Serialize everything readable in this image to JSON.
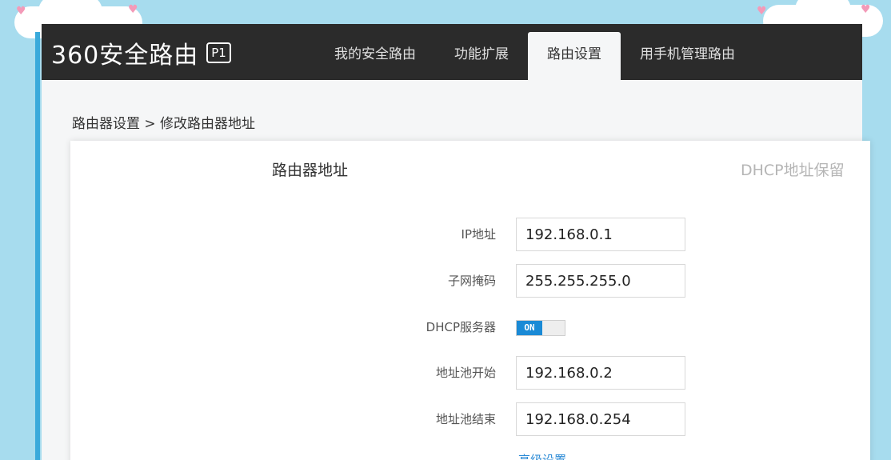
{
  "brand": {
    "name": "360安全路由",
    "model_badge": "P1"
  },
  "nav": {
    "tabs": [
      {
        "label": "我的安全路由",
        "active": false
      },
      {
        "label": "功能扩展",
        "active": false
      },
      {
        "label": "路由设置",
        "active": true
      },
      {
        "label": "用手机管理路由",
        "active": false
      }
    ]
  },
  "breadcrumb": "路由器设置 > 修改路由器地址",
  "panel": {
    "tabs": [
      {
        "label": "路由器地址",
        "active": true
      },
      {
        "label": "DHCP地址保留",
        "active": false
      }
    ],
    "fields": {
      "ip": {
        "label": "IP地址",
        "value": "192.168.0.1"
      },
      "subnet": {
        "label": "子网掩码",
        "value": "255.255.255.0"
      },
      "dhcp": {
        "label": "DHCP服务器",
        "state": "ON"
      },
      "pool_start": {
        "label": "地址池开始",
        "value": "192.168.0.2"
      },
      "pool_end": {
        "label": "地址池结束",
        "value": "192.168.0.254"
      }
    },
    "advanced_link": "高级设置"
  },
  "colors": {
    "background": "#a7dcee",
    "topbar": "#2b2b2b",
    "toggle_on": "#1a8ad6",
    "link": "#2a8ad6"
  }
}
